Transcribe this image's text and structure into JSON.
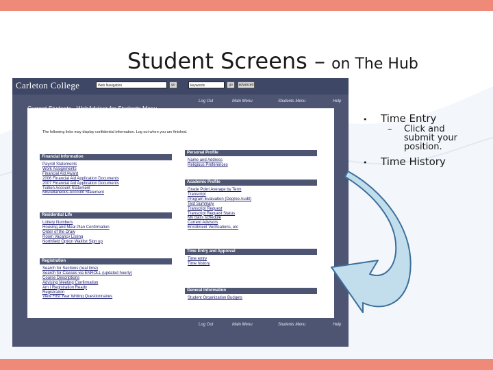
{
  "slide": {
    "title": "Student Screens –",
    "title_suffix": "on The Hub"
  },
  "bullets": {
    "items": [
      {
        "text": "Time Entry",
        "sub": [
          "Click and submit your position."
        ]
      },
      {
        "text": "Time History",
        "sub": []
      }
    ]
  },
  "screenshot": {
    "logo": "Carleton College",
    "search_select": "Web Navigation",
    "go_label": "go",
    "search_input": "keywords",
    "search_go_label": "go",
    "search_advanced_label": "advanced",
    "nav_top": [
      "Log Out",
      "Main Menu",
      "Students Menu",
      "Help"
    ],
    "nav_bottom": [
      "Log Out",
      "Main Menu",
      "Students Menu",
      "Help"
    ],
    "page_heading": "Current Students - WebAdvisor for Students Menu",
    "notice": "The following links may display confidential information. Log out when you are finished.",
    "sections_left": [
      {
        "title": "Financial Information",
        "links": [
          "Payroll Statements",
          "Work Assignments",
          "Financial Aid Award",
          "2006 Financial Aid Application Documents",
          "2007 Financial Aid Application Documents",
          "Tuition Account Statement",
          "Miscellaneous Account Statement"
        ]
      },
      {
        "title": "Residential Life",
        "links": [
          "Lottery Numbers",
          "Housing and Meal Plan Confirmation",
          "Order of the Draw",
          "Room Vacancy Listing",
          "Northfield Option Waitlist Sign up"
        ]
      },
      {
        "title": "Registration",
        "links": [
          "Search for Sections (real time)",
          "Search for Classes via ENROLL (updated hourly)",
          "Course Descriptions",
          "Advising Meeting Confirmation",
          "Am I Registration Ready",
          "Registration",
          "View First Year Writing Questionnaires"
        ]
      }
    ],
    "sections_right": [
      {
        "title": "Personal Profile",
        "links": [
          "Name and Address",
          "Religious Preferences"
        ]
      },
      {
        "title": "Academic Profile",
        "links": [
          "Grade Point Average by Term",
          "Transcript",
          "Program Evaluation (Degree Audit)",
          "Test Summary",
          "Transcript Request",
          "Transcript Request Status",
          "My class schedule",
          "Current Advisors",
          "Enrollment Verifications, etc"
        ]
      },
      {
        "title": "Time Entry and Approval",
        "links": [
          "Time entry",
          "Time history"
        ]
      },
      {
        "title": "General Information",
        "links": [
          "Student Organization Budgets"
        ]
      }
    ]
  },
  "colors": {
    "accent_bar": "#f08a78",
    "panel_bg": "#4d5573",
    "arrow_fill": "#c2ddeb",
    "arrow_stroke": "#3b6f9c"
  }
}
